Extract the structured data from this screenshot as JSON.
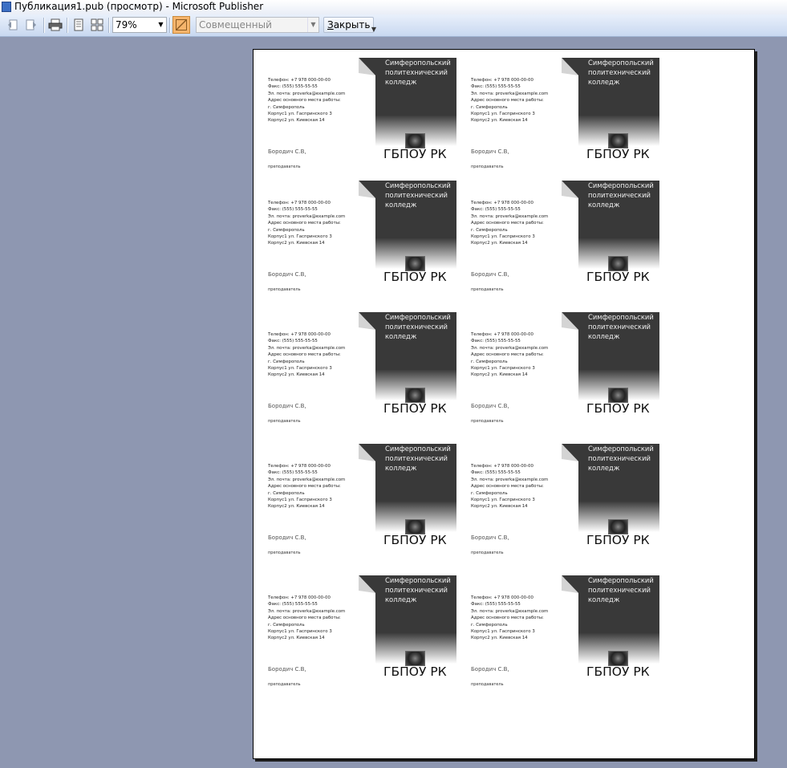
{
  "window": {
    "title": "Публикация1.pub (просмотр)  - Microsoft Publisher"
  },
  "toolbar": {
    "zoom_value": "79%",
    "view_mode": "Совмещенный",
    "close_label_underlined": "З",
    "close_label_rest": "акрыть"
  },
  "card": {
    "college_line1": "Симферопольский",
    "college_line2": "политехнический",
    "college_line3": "колледж",
    "phone": "Телефон: +7 978 000-00-00",
    "fax": "Факс: (555) 555-55-55",
    "email": "Эл. почта: proverka@example.com",
    "address_label": "Адрес основного места работы:",
    "city": "г. Симферополь",
    "building1": "Корпус1 ул. Гаспринского 3",
    "building2": "Корпус2 ул. Киевская 14",
    "person_name": "Бородич С.В,",
    "position": "преподаватель",
    "org": "ГБПОУ РК"
  }
}
